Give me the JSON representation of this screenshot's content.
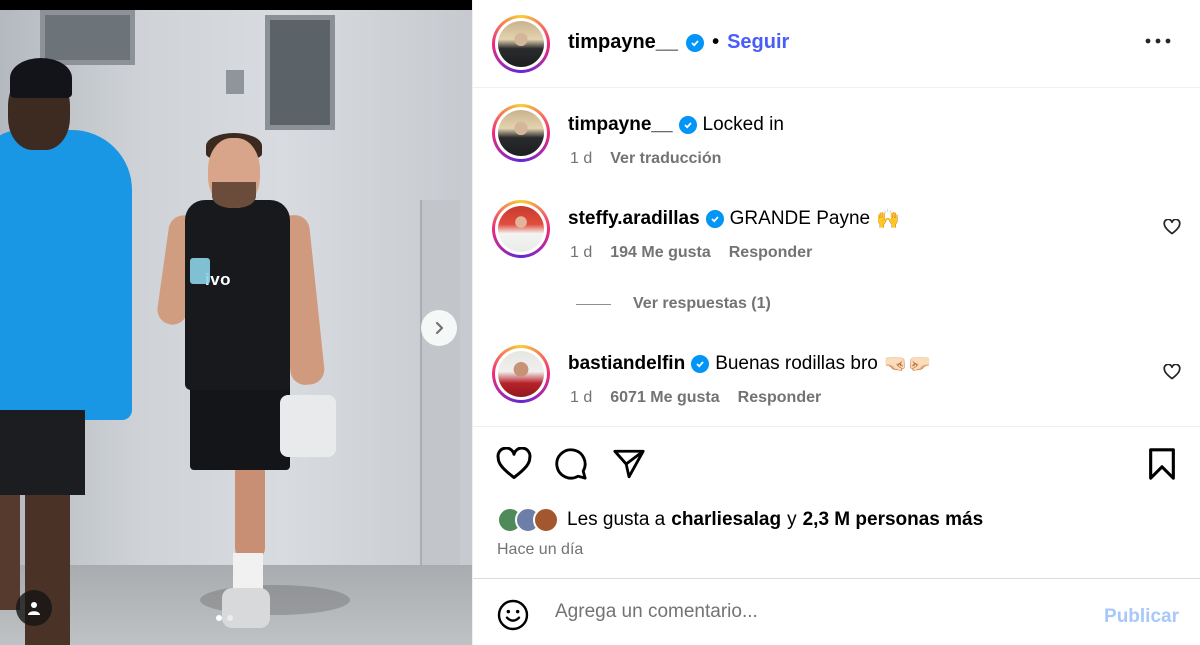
{
  "post": {
    "author": "timpayne__",
    "follow_label": "Seguir",
    "more_icon": "more-horizontal-icon"
  },
  "media": {
    "shirt_logo": "ivo",
    "carousel": {
      "total": 2,
      "current": 1
    }
  },
  "caption": {
    "user": "timpayne__",
    "text": "Locked in",
    "age": "1 d",
    "translate_label": "Ver traducción"
  },
  "comments": [
    {
      "user": "steffy.aradillas",
      "text": "GRANDE Payne",
      "emoji": "🙌",
      "age": "1 d",
      "likes": "194 Me gusta",
      "reply_label": "Responder",
      "view_replies": "Ver respuestas (1)"
    },
    {
      "user": "bastiandelfin",
      "text": "Buenas rodillas bro",
      "emoji": "🤜🏻🤛🏻",
      "age": "1 d",
      "likes": "6071 Me gusta",
      "reply_label": "Responder"
    }
  ],
  "likes": {
    "prefix": "Les gusta a",
    "user": "charliesalag",
    "connector": "y",
    "others": "2,3 M personas más"
  },
  "date": "Hace un día",
  "composer": {
    "placeholder": "Agrega un comentario...",
    "publish_label": "Publicar"
  },
  "colors": {
    "verified": "#0095f6",
    "follow": "#4a5df9",
    "publish_disabled": "#a8c7fa",
    "secondary_text": "#737373"
  }
}
